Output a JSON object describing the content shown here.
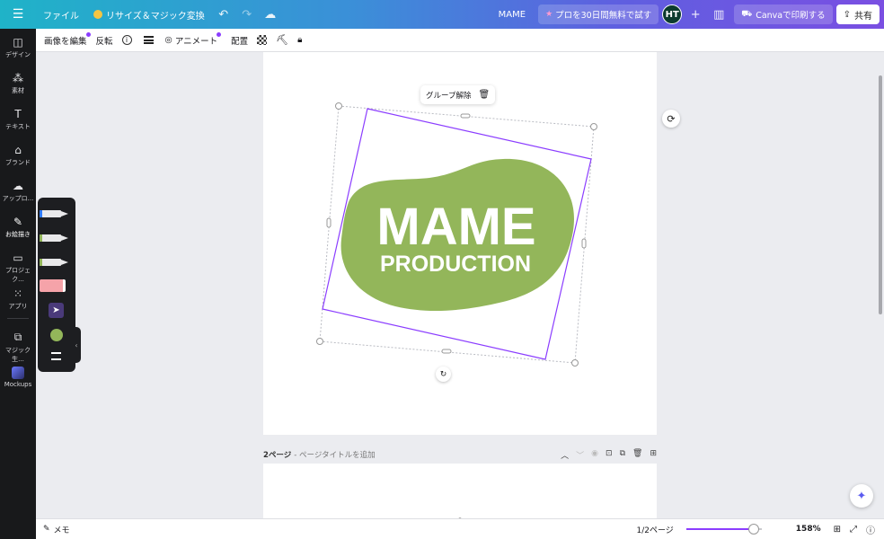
{
  "topbar": {
    "menu_icon": "hamburger-icon",
    "file_label": "ファイル",
    "resize_label": "リサイズ＆マジック変換",
    "doc_title": "MAME",
    "pro_label": "プロを30日間無料で試す",
    "avatar_initials": "HT",
    "print_label": "Canvaで印刷する",
    "share_label": "共有"
  },
  "sidebar": {
    "items": [
      {
        "label": "デザイン",
        "icon": "layout-icon"
      },
      {
        "label": "素材",
        "icon": "elements-icon"
      },
      {
        "label": "テキスト",
        "icon": "text-icon"
      },
      {
        "label": "ブランド",
        "icon": "brand-icon"
      },
      {
        "label": "アップロ...",
        "icon": "upload-icon"
      },
      {
        "label": "お絵描き",
        "icon": "draw-icon"
      },
      {
        "label": "プロジェク...",
        "icon": "folder-icon"
      },
      {
        "label": "アプリ",
        "icon": "apps-icon"
      },
      {
        "label": "マジック生...",
        "icon": "magic-media-icon"
      },
      {
        "label": "Mockups",
        "icon": "mockups-icon"
      }
    ]
  },
  "context_toolbar": {
    "edit_image": "画像を編集",
    "flip": "反転",
    "animate": "アニメート",
    "position": "配置"
  },
  "canvas": {
    "group_popup_label": "グループ解除",
    "logo_line1": "MAME",
    "logo_line2": "PRODUCTION",
    "logo_color": "#93b65a",
    "selection_color": "#8b3dff"
  },
  "page2": {
    "title": "2ページ",
    "subtitle": "- ページタイトルを追加"
  },
  "bottombar": {
    "notes_label": "メモ",
    "page_indicator": "1/2ページ",
    "zoom_label": "158%",
    "zoom_fraction": 0.9
  },
  "palette": {
    "pens": [
      {
        "band_color": "#2f7bff"
      },
      {
        "band_color": "#93b65a"
      },
      {
        "band_color": "#93b65a"
      }
    ],
    "selected_color": "#93b65a"
  }
}
